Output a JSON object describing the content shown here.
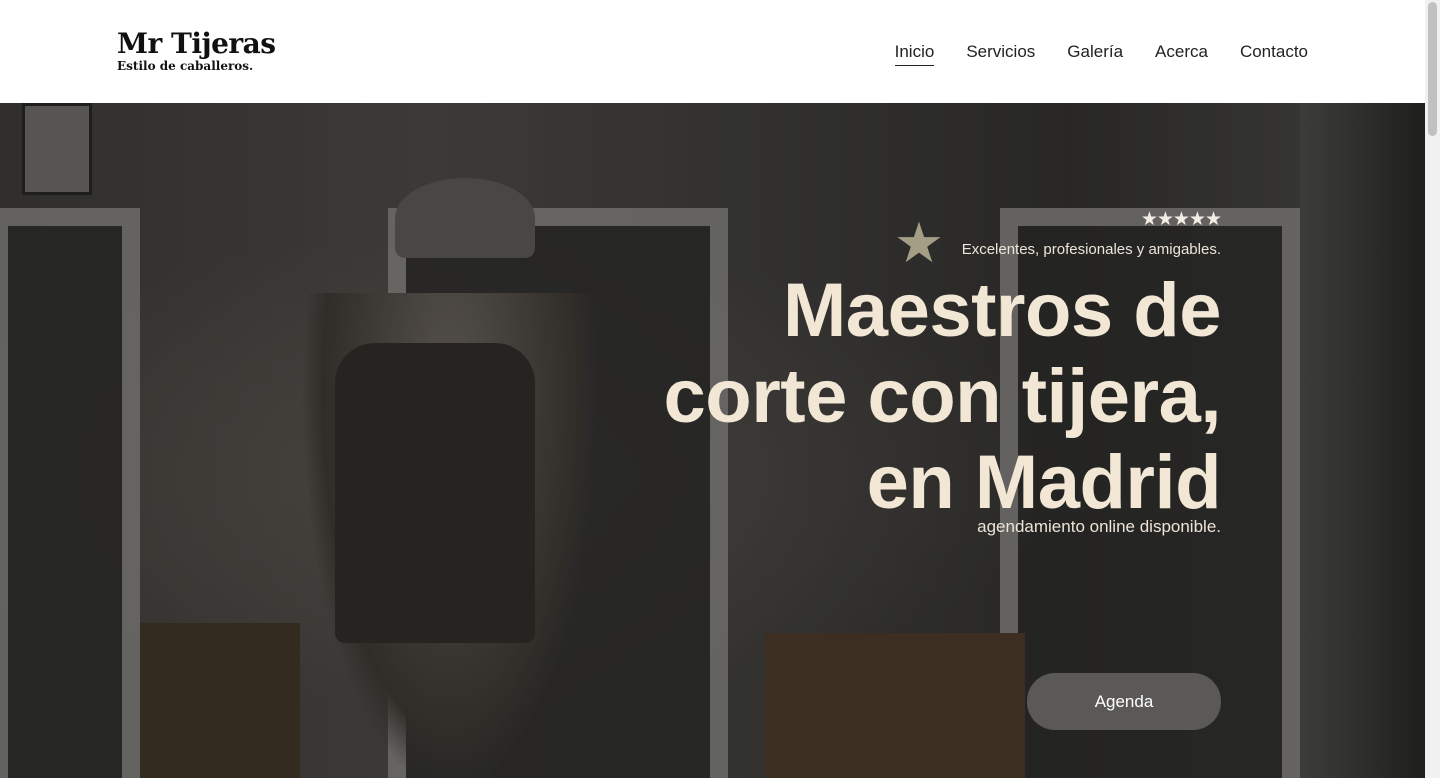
{
  "header": {
    "logo_title": "Mr Tijeras",
    "logo_tagline": "Estilo de caballeros.",
    "nav": [
      {
        "label": "Inicio",
        "active": true
      },
      {
        "label": "Servicios",
        "active": false
      },
      {
        "label": "Galería",
        "active": false
      },
      {
        "label": "Acerca",
        "active": false
      },
      {
        "label": "Contacto",
        "active": false
      }
    ]
  },
  "hero": {
    "stars": "★★★★★",
    "rating_text": "Excelentes, profesionales y amigables.",
    "headline": "Maestros de corte con tijera, en Madrid",
    "subtext": "agendamiento online disponible.",
    "cta_label": "Agenda",
    "deco_star": "★"
  },
  "colors": {
    "headline": "#f2e6d5",
    "cta_bg": "#5b5957",
    "deco_star": "#a39e85"
  }
}
